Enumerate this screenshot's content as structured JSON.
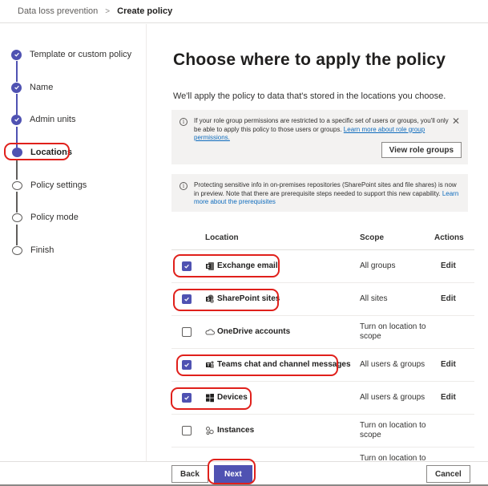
{
  "breadcrumb": {
    "parent": "Data loss prevention",
    "separator": ">",
    "current": "Create policy"
  },
  "steps": [
    {
      "label": "Template or custom policy",
      "state": "done"
    },
    {
      "label": "Name",
      "state": "done"
    },
    {
      "label": "Admin units",
      "state": "done"
    },
    {
      "label": "Locations",
      "state": "current"
    },
    {
      "label": "Policy settings",
      "state": "todo"
    },
    {
      "label": "Policy mode",
      "state": "todo"
    },
    {
      "label": "Finish",
      "state": "todo"
    }
  ],
  "main": {
    "title": "Choose where to apply the policy",
    "subtitle": "We'll apply the policy to data that's stored in the locations you choose."
  },
  "role_notice": {
    "text": "If your role group permissions are restricted to a specific set of users or groups, you'll only be able to apply this policy to those users or groups.",
    "link": "Learn more about role group permissions.",
    "button": "View role groups"
  },
  "onprem_notice": {
    "text": "Protecting sensitive info in on-premises repositories (SharePoint sites and file shares) is now in preview. Note that there are prerequisite steps needed to support this new capability.",
    "link": "Learn more about the prerequisites"
  },
  "table": {
    "headers": {
      "location": "Location",
      "scope": "Scope",
      "actions": "Actions"
    },
    "rows": [
      {
        "name": "Exchange email",
        "checked": true,
        "scope": "All groups",
        "action": "Edit",
        "icon": "exchange-icon"
      },
      {
        "name": "SharePoint sites",
        "checked": true,
        "scope": "All sites",
        "action": "Edit",
        "icon": "sharepoint-icon"
      },
      {
        "name": "OneDrive accounts",
        "checked": false,
        "scope": "Turn on location to scope",
        "action": "",
        "icon": "onedrive-icon"
      },
      {
        "name": "Teams chat and channel messages",
        "checked": true,
        "scope": "All users & groups",
        "action": "Edit",
        "icon": "teams-icon"
      },
      {
        "name": "Devices",
        "checked": true,
        "scope": "All users & groups",
        "action": "Edit",
        "icon": "windows-icon"
      },
      {
        "name": "Instances",
        "checked": false,
        "scope": "Turn on location to scope",
        "action": "",
        "icon": "instances-icon"
      },
      {
        "name": "",
        "checked": false,
        "scope": "Turn on location to",
        "action": "",
        "icon": ""
      }
    ]
  },
  "footer": {
    "back": "Back",
    "next": "Next",
    "cancel": "Cancel"
  },
  "colors": {
    "accent": "#4f52b2",
    "annotation": "#e0201b",
    "link": "#0f6cbd"
  }
}
